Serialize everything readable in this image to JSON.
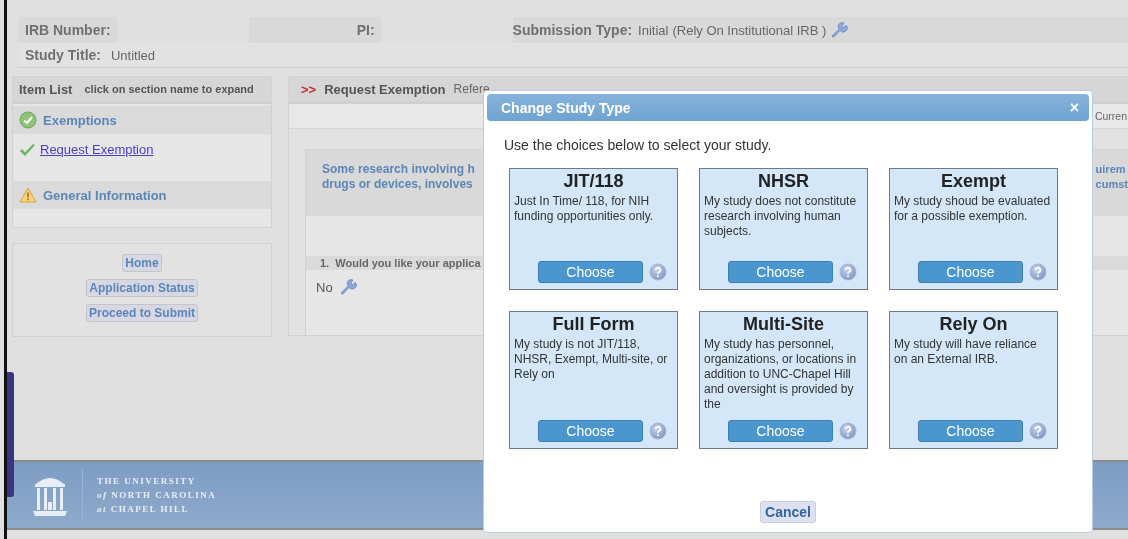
{
  "header": {
    "irb_number_label": "IRB Number:",
    "pi_label": "PI:",
    "submission_type_label": "Submission Type:",
    "submission_type": "Initial",
    "submission_note": "(Rely On Institutional IRB )",
    "study_title_label": "Study Title:",
    "study_title": "Untitled"
  },
  "item_list": {
    "title": "Item List",
    "hint": "click on section name to expand",
    "sections": [
      {
        "label": "Exemptions",
        "kind": "complete",
        "items": [
          {
            "label": "Request Exemption",
            "kind": "complete"
          }
        ]
      },
      {
        "label": "General Information",
        "kind": "warning"
      }
    ]
  },
  "nav_buttons": [
    "Home",
    "Application Status",
    "Proceed to Submit"
  ],
  "panel": {
    "marker": ">>",
    "title": "Request Exemption",
    "reference": "Refere",
    "tab_fragment": "Curren",
    "intro_left": [
      "Some research involving h",
      "drugs or devices, involves"
    ],
    "intro_right": [
      "uirem",
      "cumst"
    ],
    "question": "1.  Would you like your applica",
    "answer": "No"
  },
  "footer": {
    "lines": [
      "THE UNIVERSITY",
      "*of* NORTH CAROLINA",
      "*at* CHAPEL HILL"
    ]
  },
  "modal": {
    "title": "Change Study Type",
    "close": "×",
    "prompt": "Use the choices below to select your study.",
    "choices": [
      {
        "title": "JIT/118",
        "description": "Just In Time/ 118, for NIH funding opportunities only.",
        "button": "Choose"
      },
      {
        "title": "NHSR",
        "description": "My study does not constitute research involving human subjects.",
        "button": "Choose"
      },
      {
        "title": "Exempt",
        "description": "My study shoud be evaluated for a possible exemption.",
        "button": "Choose"
      },
      {
        "title": "Full Form",
        "description": "My study is not JIT/118, NHSR, Exempt, Multi-site, or Rely on",
        "button": "Choose"
      },
      {
        "title": "Multi-Site",
        "description": "My study has personnel, organizations, or locations in addition to UNC-Chapel Hill and oversight is provided by the",
        "button": "Choose"
      },
      {
        "title": "Rely On",
        "description": "My study will have reliance on an External IRB.",
        "button": "Choose"
      }
    ],
    "cancel": "Cancel"
  }
}
